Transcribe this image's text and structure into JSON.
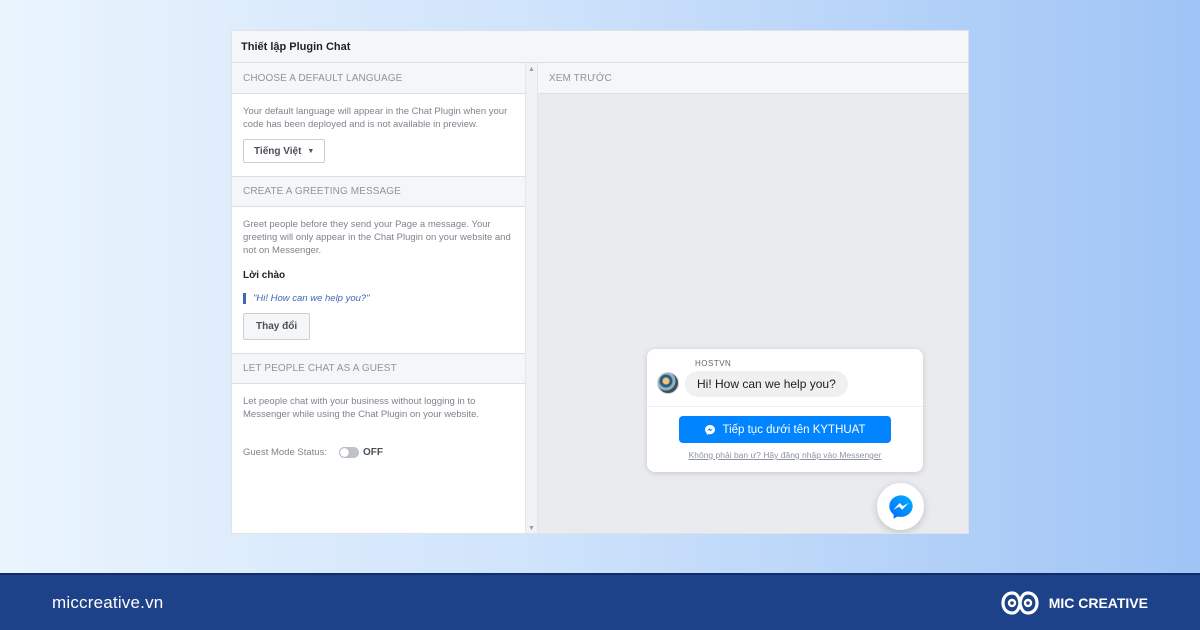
{
  "dialog": {
    "title": "Thiết lập Plugin Chat",
    "language": {
      "title": "CHOOSE A DEFAULT LANGUAGE",
      "description": "Your default language will appear in the Chat Plugin when your code has been deployed and is not available in preview.",
      "selected": "Tiếng Việt"
    },
    "greeting": {
      "title": "CREATE A GREETING MESSAGE",
      "description": "Greet people before they send your Page a message. Your greeting will only appear in the Chat Plugin on your website and not on Messenger.",
      "label": "Lời chào",
      "message": "\"Hi! How can we help you?\"",
      "change_button": "Thay đổi"
    },
    "guest": {
      "title": "LET PEOPLE CHAT AS A GUEST",
      "description": "Let people chat with your business without logging in to Messenger while using the Chat Plugin on your website.",
      "status_label": "Guest Mode Status:",
      "status_value": "OFF"
    },
    "preview": {
      "title": "XEM TRƯỚC",
      "page_name": "HOSTVN",
      "bubble_text": "Hi! How can we help you?",
      "continue_button": "Tiếp tục dưới tên KYTHUAT",
      "not_you_link": "Không phải bạn ư? Hãy đăng nhập vào Messenger"
    }
  },
  "footer": {
    "site": "miccreative.vn",
    "brand": "MIC CREATIVE"
  },
  "colors": {
    "messenger_blue": "#0084ff",
    "footer_bg": "#1d4289",
    "greeting_accent": "#4267b2"
  },
  "icons": {
    "dropdown": "caret-down-icon",
    "scroll_up": "scroll-up-arrow-icon",
    "scroll_down": "scroll-down-arrow-icon",
    "messenger": "messenger-icon",
    "brand_logo": "mic-logo-icon"
  }
}
